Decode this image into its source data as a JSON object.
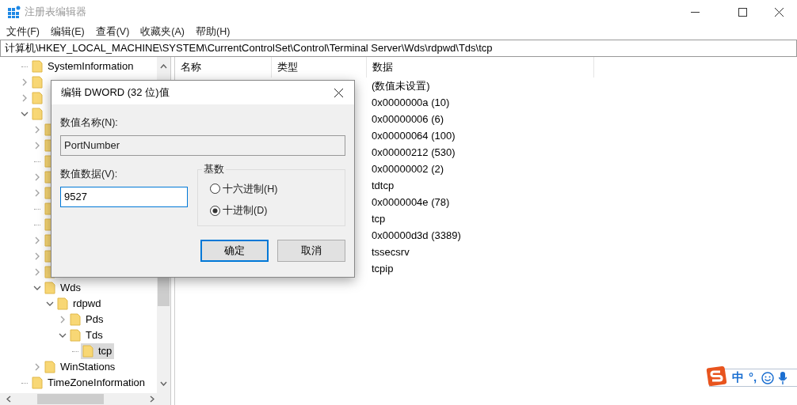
{
  "window": {
    "title": "注册表编辑器"
  },
  "menu": [
    "文件(F)",
    "编辑(E)",
    "查看(V)",
    "收藏夹(A)",
    "帮助(H)"
  ],
  "address": "计算机\\HKEY_LOCAL_MACHINE\\SYSTEM\\CurrentControlSet\\Control\\Terminal Server\\Wds\\rdpwd\\Tds\\tcp",
  "tree": [
    {
      "kind": "leaf",
      "label": "SystemInformation",
      "selected": false
    },
    {
      "kind": "branch",
      "expanded": false,
      "selected": false
    },
    {
      "kind": "branch",
      "expanded": false,
      "selected": false
    },
    {
      "kind": "branch",
      "expanded": true,
      "selected": false,
      "children": [
        {
          "kind": "branch",
          "expanded": false,
          "selected": false
        },
        {
          "kind": "branch",
          "expanded": false,
          "selected": false
        },
        {
          "kind": "leaf",
          "selected": false
        },
        {
          "kind": "branch",
          "expanded": false,
          "selected": false
        },
        {
          "kind": "branch",
          "expanded": false,
          "selected": false
        },
        {
          "kind": "leaf",
          "selected": false
        },
        {
          "kind": "leaf",
          "selected": false
        },
        {
          "kind": "branch",
          "expanded": false,
          "selected": false
        },
        {
          "kind": "branch",
          "expanded": false,
          "selected": false
        },
        {
          "kind": "branch",
          "expanded": false,
          "selected": false
        },
        {
          "kind": "branch",
          "label": "Wds",
          "expanded": true,
          "selected": false,
          "children": [
            {
              "kind": "branch",
              "label": "rdpwd",
              "expanded": true,
              "selected": false,
              "children": [
                {
                  "kind": "branch",
                  "label": "Pds",
                  "expanded": false,
                  "selected": false
                },
                {
                  "kind": "branch",
                  "label": "Tds",
                  "expanded": true,
                  "selected": false,
                  "children": [
                    {
                      "kind": "leaf",
                      "label": "tcp",
                      "selected": true
                    }
                  ]
                }
              ]
            }
          ]
        },
        {
          "kind": "branch",
          "label": "WinStations",
          "expanded": false,
          "selected": false
        }
      ]
    },
    {
      "kind": "leaf",
      "label": "TimeZoneInformation",
      "selected": false
    }
  ],
  "list": {
    "columns": [
      "名称",
      "类型",
      "数据"
    ],
    "rows": [
      {
        "data": "(数值未设置)"
      },
      {
        "data": "0x0000000a (10)"
      },
      {
        "data": "0x00000006 (6)"
      },
      {
        "data": "0x00000064 (100)"
      },
      {
        "data": "0x00000212 (530)"
      },
      {
        "data": "0x00000002 (2)"
      },
      {
        "data": "tdtcp"
      },
      {
        "data": "0x0000004e (78)"
      },
      {
        "data": "tcp"
      },
      {
        "data": "0x00000d3d (3389)"
      },
      {
        "data": "tssecsrv"
      },
      {
        "data": "tcpip"
      }
    ]
  },
  "dialog": {
    "title": "编辑 DWORD (32 位)值",
    "name_label": "数值名称(N):",
    "name_value": "PortNumber",
    "data_label": "数值数据(V):",
    "data_value": "9527",
    "base_label": "基数",
    "bases": [
      {
        "label": "十六进制(H)",
        "selected": false
      },
      {
        "label": "十进制(D)",
        "selected": true
      }
    ],
    "buttons": [
      {
        "label": "确定",
        "default": true
      },
      {
        "label": "取消",
        "default": false
      }
    ]
  },
  "ime": {
    "items": [
      "中",
      "°,"
    ]
  }
}
